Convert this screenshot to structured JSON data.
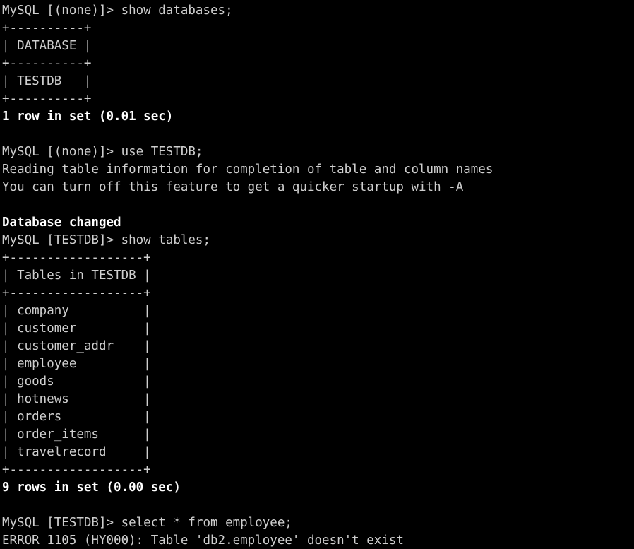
{
  "terminal": {
    "title": "MySQL client session",
    "background_color": "#000000",
    "foreground_color": "#cfcfcf",
    "bold_color": "#ffffff",
    "columns": 67,
    "rows": 31,
    "lines": [
      {
        "text": "MySQL [(none)]> show databases;",
        "bold": false,
        "kind": "prompt"
      },
      {
        "text": "+----------+",
        "bold": false,
        "kind": "table-border"
      },
      {
        "text": "| DATABASE |",
        "bold": false,
        "kind": "table-header"
      },
      {
        "text": "+----------+",
        "bold": false,
        "kind": "table-border"
      },
      {
        "text": "| TESTDB   |",
        "bold": false,
        "kind": "table-row"
      },
      {
        "text": "+----------+",
        "bold": false,
        "kind": "table-border"
      },
      {
        "text": "1 row in set (0.01 sec)",
        "bold": true,
        "kind": "status"
      },
      {
        "text": "",
        "bold": false,
        "kind": "blank"
      },
      {
        "text": "MySQL [(none)]> use TESTDB;",
        "bold": false,
        "kind": "prompt"
      },
      {
        "text": "Reading table information for completion of table and column names",
        "bold": false,
        "kind": "output"
      },
      {
        "text": "You can turn off this feature to get a quicker startup with -A",
        "bold": false,
        "kind": "output"
      },
      {
        "text": "",
        "bold": false,
        "kind": "blank"
      },
      {
        "text": "Database changed",
        "bold": true,
        "kind": "status"
      },
      {
        "text": "MySQL [TESTDB]> show tables;",
        "bold": false,
        "kind": "prompt"
      },
      {
        "text": "+------------------+",
        "bold": false,
        "kind": "table-border"
      },
      {
        "text": "| Tables in TESTDB |",
        "bold": false,
        "kind": "table-header"
      },
      {
        "text": "+------------------+",
        "bold": false,
        "kind": "table-border"
      },
      {
        "text": "| company          |",
        "bold": false,
        "kind": "table-row"
      },
      {
        "text": "| customer         |",
        "bold": false,
        "kind": "table-row"
      },
      {
        "text": "| customer_addr    |",
        "bold": false,
        "kind": "table-row"
      },
      {
        "text": "| employee         |",
        "bold": false,
        "kind": "table-row"
      },
      {
        "text": "| goods            |",
        "bold": false,
        "kind": "table-row"
      },
      {
        "text": "| hotnews          |",
        "bold": false,
        "kind": "table-row"
      },
      {
        "text": "| orders           |",
        "bold": false,
        "kind": "table-row"
      },
      {
        "text": "| order_items      |",
        "bold": false,
        "kind": "table-row"
      },
      {
        "text": "| travelrecord     |",
        "bold": false,
        "kind": "table-row"
      },
      {
        "text": "+------------------+",
        "bold": false,
        "kind": "table-border"
      },
      {
        "text": "9 rows in set (0.00 sec)",
        "bold": true,
        "kind": "status"
      },
      {
        "text": "",
        "bold": false,
        "kind": "blank"
      },
      {
        "text": "MySQL [TESTDB]> select * from employee;",
        "bold": false,
        "kind": "prompt"
      },
      {
        "text": "ERROR 1105 (HY000): Table 'db2.employee' doesn't exist",
        "bold": false,
        "kind": "error"
      }
    ],
    "session": {
      "prompt_none": "MySQL [(none)]>",
      "prompt_db": "MySQL [TESTDB]>",
      "database": "TESTDB",
      "commands": [
        "show databases;",
        "use TESTDB;",
        "show tables;",
        "select * from employee;"
      ],
      "databases": [
        "TESTDB"
      ],
      "databases_header": "DATABASE",
      "tables_header": "Tables in TESTDB",
      "tables": [
        "company",
        "customer",
        "customer_addr",
        "employee",
        "goods",
        "hotnews",
        "orders",
        "order_items",
        "travelrecord"
      ],
      "databases_result": "1 row in set (0.01 sec)",
      "tables_result": "9 rows in set (0.00 sec)",
      "database_changed_message": "Database changed",
      "reading_info_1": "Reading table information for completion of table and column names",
      "reading_info_2": "You can turn off this feature to get a quicker startup with -A",
      "error": {
        "code": "1105",
        "sqlstate": "HY000",
        "message": "ERROR 1105 (HY000): Table 'db2.employee' doesn't exist",
        "table": "db2.employee"
      }
    }
  }
}
